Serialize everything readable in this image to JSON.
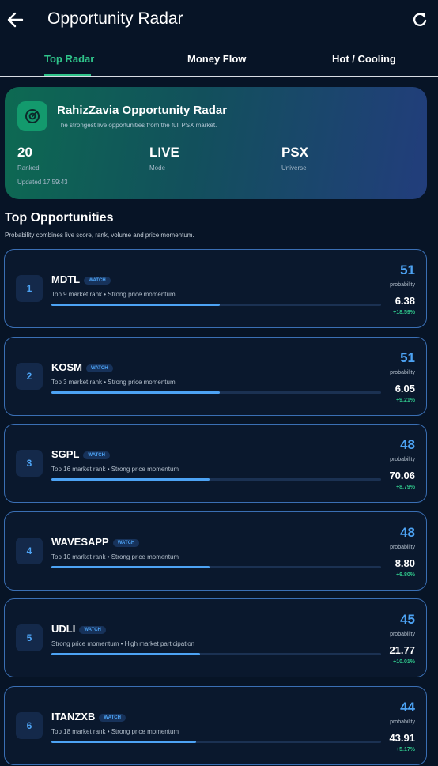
{
  "appbar": {
    "title": "Opportunity Radar"
  },
  "tabs": [
    {
      "label": "Top Radar",
      "active": true
    },
    {
      "label": "Money Flow",
      "active": false
    },
    {
      "label": "Hot / Cooling",
      "active": false
    }
  ],
  "hero": {
    "title": "RahizZavia Opportunity Radar",
    "subtitle": "The strongest live opportunities from the full PSX market.",
    "stats": [
      {
        "value": "20",
        "label": "Ranked"
      },
      {
        "value": "LIVE",
        "label": "Mode"
      },
      {
        "value": "PSX",
        "label": "Universe"
      }
    ],
    "updated": "Updated 17:59:43"
  },
  "section": {
    "title": "Top Opportunities",
    "subtitle": "Probability combines live score, rank, volume and price momentum."
  },
  "badge_label": "WATCH",
  "probability_label": "probability",
  "opportunities": [
    {
      "rank": "1",
      "ticker": "MDTL",
      "reason": "Top 9 market rank • Strong price momentum",
      "probability": "51",
      "progress": 0.51,
      "price": "6.38",
      "change": "+18.59%"
    },
    {
      "rank": "2",
      "ticker": "KOSM",
      "reason": "Top 3 market rank • Strong price momentum",
      "probability": "51",
      "progress": 0.51,
      "price": "6.05",
      "change": "+9.21%"
    },
    {
      "rank": "3",
      "ticker": "SGPL",
      "reason": "Top 16 market rank • Strong price momentum",
      "probability": "48",
      "progress": 0.48,
      "price": "70.06",
      "change": "+8.79%"
    },
    {
      "rank": "4",
      "ticker": "WAVESAPP",
      "reason": "Top 10 market rank • Strong price momentum",
      "probability": "48",
      "progress": 0.48,
      "price": "8.80",
      "change": "+6.80%"
    },
    {
      "rank": "5",
      "ticker": "UDLI",
      "reason": "Strong price momentum • High market participation",
      "probability": "45",
      "progress": 0.45,
      "price": "21.77",
      "change": "+10.01%"
    },
    {
      "rank": "6",
      "ticker": "ITANZXB",
      "reason": "Top 18 market rank • Strong price momentum",
      "probability": "44",
      "progress": 0.44,
      "price": "43.91",
      "change": "+5.17%"
    }
  ],
  "colors": {
    "accent_green": "#2fc48a",
    "accent_blue": "#4da3f4",
    "background": "#071426"
  },
  "icons": {
    "back": "arrow-left-icon",
    "refresh": "refresh-icon",
    "hero": "radar-icon"
  }
}
